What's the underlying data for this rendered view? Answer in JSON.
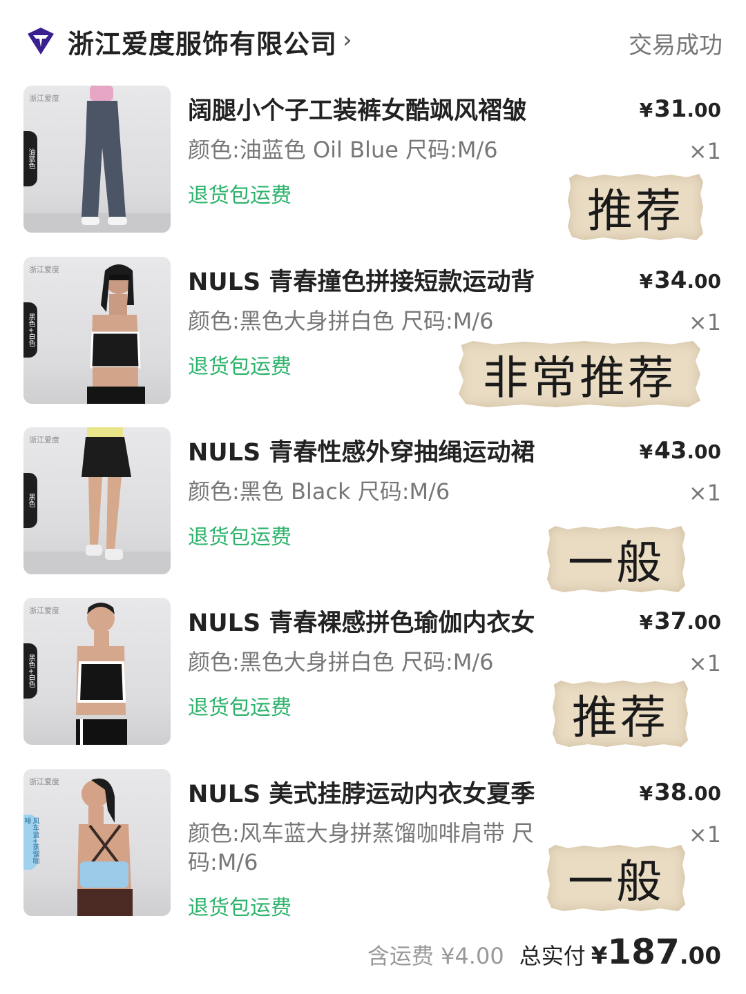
{
  "header": {
    "shop_name": "浙江爱度服饰有限公司",
    "chevron": "›",
    "status": "交易成功"
  },
  "colors": {
    "green": "#2bb36a",
    "sticker_bg": "#e9dcc3",
    "logo": "#3a1f8f"
  },
  "items": [
    {
      "title": "阔腿小个子工装裤女酷飒风褶皱",
      "variant": "颜色:油蓝色 Oil Blue 尺码:M/6",
      "shipping": "退货包运费",
      "price_cur": "¥",
      "price_int": "31",
      "price_dec": ".00",
      "qty": "×1",
      "rating": "推荐",
      "thumb_brand": "浙江爱度",
      "thumb_tag": "油蓝色"
    },
    {
      "title": "NULS 青春撞色拼接短款运动背",
      "variant": "颜色:黑色大身拼白色 尺码:M/6",
      "shipping": "退货包运费",
      "price_cur": "¥",
      "price_int": "34",
      "price_dec": ".00",
      "qty": "×1",
      "rating": "非常推荐",
      "thumb_brand": "浙江爱度",
      "thumb_tag": "黑色+白色"
    },
    {
      "title": "NULS 青春性感外穿抽绳运动裙",
      "variant": "颜色:黑色 Black 尺码:M/6",
      "shipping": "退货包运费",
      "price_cur": "¥",
      "price_int": "43",
      "price_dec": ".00",
      "qty": "×1",
      "rating": "一般",
      "thumb_brand": "浙江爱度",
      "thumb_tag": "黑色"
    },
    {
      "title": "NULS 青春裸感拼色瑜伽内衣女",
      "variant": "颜色:黑色大身拼白色 尺码:M/6",
      "shipping": "退货包运费",
      "price_cur": "¥",
      "price_int": "37",
      "price_dec": ".00",
      "qty": "×1",
      "rating": "推荐",
      "thumb_brand": "浙江爱度",
      "thumb_tag": "黑色+白色"
    },
    {
      "title": "NULS 美式挂脖运动内衣女夏季",
      "variant": "颜色:风车蓝大身拼蒸馏咖啡肩带 尺码:M/6",
      "shipping": "退货包运费",
      "price_cur": "¥",
      "price_int": "38",
      "price_dec": ".00",
      "qty": "×1",
      "rating": "一般",
      "thumb_brand": "浙江爱度",
      "thumb_tag": "风车蓝+蒸馏咖啡"
    }
  ],
  "footer": {
    "shipping_fee": "含运费 ¥4.00",
    "total_label": "总实付",
    "total_cur": "¥",
    "total_int": "187",
    "total_dec": ".00"
  }
}
